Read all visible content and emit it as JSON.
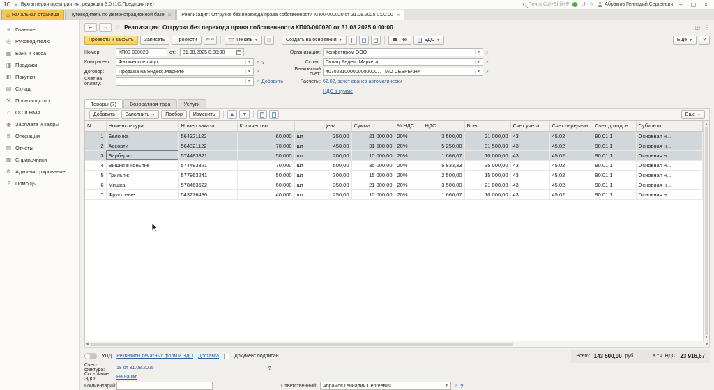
{
  "titlebar": {
    "logo": "1С",
    "title": "Бухгалтерия предприятия, редакция 3.0 (1С:Предприятие)",
    "search": "Поиск Ctrl+Shift+F",
    "user": "Абрамов Геннадий Сергеевич"
  },
  "tabs": {
    "home": "Начальная страница",
    "guide": "Путеводитель по демонстрационной базе",
    "doc": "Реализация: Отгрузка без перехода права собственности КП00-000020 от 31.08.2025 0:00:00"
  },
  "sidebar": [
    {
      "label": "Главное",
      "icon": "≡"
    },
    {
      "label": "Руководителю",
      "icon": "◷"
    },
    {
      "label": "Банк и касса",
      "icon": "▦"
    },
    {
      "label": "Продажи",
      "icon": "◨"
    },
    {
      "label": "Покупки",
      "icon": "◧"
    },
    {
      "label": "Склад",
      "icon": "▤"
    },
    {
      "label": "Производство",
      "icon": "⚒"
    },
    {
      "label": "ОС и НМА",
      "icon": "⌂"
    },
    {
      "label": "Зарплата и кадры",
      "icon": "◉"
    },
    {
      "label": "Операции",
      "icon": "≣"
    },
    {
      "label": "Отчеты",
      "icon": "▥"
    },
    {
      "label": "Справочники",
      "icon": "▩"
    },
    {
      "label": "Администрирование",
      "icon": "⚙"
    },
    {
      "label": "Помощь",
      "icon": "?"
    }
  ],
  "doc": {
    "title": "Реализация: Отгрузка без перехода права собственности КП00-000020 от 31.08.2025 0:00:00",
    "toolbar": {
      "post_close": "Провести и закрыть",
      "save": "Записать",
      "post": "Провести",
      "dtkt": "Дт Кт",
      "print": "Печать",
      "create_based": "Создать на основании",
      "check": "Чек",
      "edo": "ЭДО",
      "more": "Еще",
      "help": "?"
    },
    "form": {
      "number_label": "Номер:",
      "number": "КП00-000020",
      "date_label": "от:",
      "date": "31.08.2025 0:00:00",
      "counterparty_label": "Контрагент:",
      "counterparty": "Физическое лицо",
      "counterparty_help": "?",
      "contract_label": "Договор:",
      "contract": "Продажа на Яндекс.Маркете",
      "invoice_label": "Счет на оплату:",
      "invoice_value": "",
      "add_link": "Добавить",
      "org_label": "Организация:",
      "org": "Конфетпром ООО",
      "warehouse_label": "Склад:",
      "warehouse": "Склад Яндекс.Маркета",
      "bank_label": "Банковский счет:",
      "bank": "40702810000000000007, ПАО СБЕРБАНК",
      "settlements_label": "Расчеты:",
      "settlements_link": "62.02, зачет аванса автоматически",
      "vat_link": "НДС в сумме"
    },
    "parts_tabs": [
      {
        "label": "Товары (7)",
        "active": true
      },
      {
        "label": "Возвратная тара"
      },
      {
        "label": "Услуги"
      }
    ],
    "table_toolbar": {
      "add": "Добавить",
      "fill": "Заполнить",
      "pick": "Подбор",
      "edit": "Изменить",
      "more": "Еще"
    },
    "table": {
      "headers": {
        "n": "N",
        "name": "Номенклатура",
        "order": "Номер заказа",
        "qty": "Количество",
        "unit": "",
        "price": "Цена",
        "sum": "Сумма",
        "vat_pct": "% НДС",
        "vat": "НДС",
        "total": "Всего",
        "account": "Счет учета",
        "transfer": "Счет передачи",
        "income": "Счет доходов",
        "subconto": "Субконто"
      },
      "rows": [
        {
          "n": "1",
          "name": "Белочка",
          "order": "564321122",
          "qty": "60,000",
          "unit": "шт",
          "price": "350,00",
          "sum": "21 000,00",
          "vat_pct": "20%",
          "vat": "3 500,00",
          "total": "21 000,00",
          "account": "43",
          "transfer": "45.02",
          "income": "90.01.1",
          "subconto": "Основная н...",
          "selected": true
        },
        {
          "n": "2",
          "name": "Ассорти",
          "order": "564321122",
          "qty": "70,000",
          "unit": "шт",
          "price": "450,00",
          "sum": "31 500,00",
          "vat_pct": "20%",
          "vat": "5 250,00",
          "total": "31 500,00",
          "account": "43",
          "transfer": "45.02",
          "income": "90.01.1",
          "subconto": "Основная н...",
          "selected": true
        },
        {
          "n": "3",
          "name": "Барбарис",
          "order": "574483321",
          "qty": "50,000",
          "unit": "шт",
          "price": "200,00",
          "sum": "10 000,00",
          "vat_pct": "20%",
          "vat": "1 666,67",
          "total": "10 000,00",
          "account": "43",
          "transfer": "45.02",
          "income": "90.01.1",
          "subconto": "Основная н...",
          "selected": true,
          "current": true
        },
        {
          "n": "4",
          "name": "Вишня в коньяке",
          "order": "574483321",
          "qty": "70,000",
          "unit": "шт",
          "price": "500,00",
          "sum": "35 000,00",
          "vat_pct": "20%",
          "vat": "5 833,33",
          "total": "35 000,00",
          "account": "43",
          "transfer": "45.02",
          "income": "90.01.1",
          "subconto": "Основная н..."
        },
        {
          "n": "5",
          "name": "Грильяж",
          "order": "577863241",
          "qty": "50,000",
          "unit": "шт",
          "price": "300,00",
          "sum": "15 000,00",
          "vat_pct": "20%",
          "vat": "2 500,00",
          "total": "15 000,00",
          "account": "43",
          "transfer": "45.02",
          "income": "90.01.1",
          "subconto": "Основная н..."
        },
        {
          "n": "6",
          "name": "Мишка",
          "order": "578463522",
          "qty": "60,000",
          "unit": "шт",
          "price": "350,00",
          "sum": "21 000,00",
          "vat_pct": "20%",
          "vat": "3 500,00",
          "total": "21 000,00",
          "account": "43",
          "transfer": "45.02",
          "income": "90.01.1",
          "subconto": "Основная н..."
        },
        {
          "n": "7",
          "name": "Фруктовые",
          "order": "543276436",
          "qty": "40,000",
          "unit": "шт",
          "price": "250,00",
          "sum": "10 000,00",
          "vat_pct": "20%",
          "vat": "1 666,67",
          "total": "10 000,00",
          "account": "43",
          "transfer": "45.02",
          "income": "90.01.1",
          "subconto": "Основная н..."
        }
      ]
    },
    "footer": {
      "upd_label": "УПД",
      "requisites_link": "Реквизиты печатных форм и ЭДО",
      "delivery_link": "Доставка",
      "signed_label": "Документ подписан",
      "total_label": "Всего:",
      "total": "143 500,00",
      "currency": "руб.",
      "vat_label": "в т.ч. НДС:",
      "vat": "23 916,67"
    },
    "bottom": {
      "invoice_label": "Счет-фактура:",
      "invoice_link": "18 от 31.08.2025",
      "invoice_help": "?",
      "edo_label": "Состояние ЭДО:",
      "edo_link": "Не начат",
      "comment_label": "Комментарий:",
      "responsible_label": "Ответственный:",
      "responsible": "Абрамов Геннадий Сергеевич",
      "responsible_help": "?"
    }
  }
}
